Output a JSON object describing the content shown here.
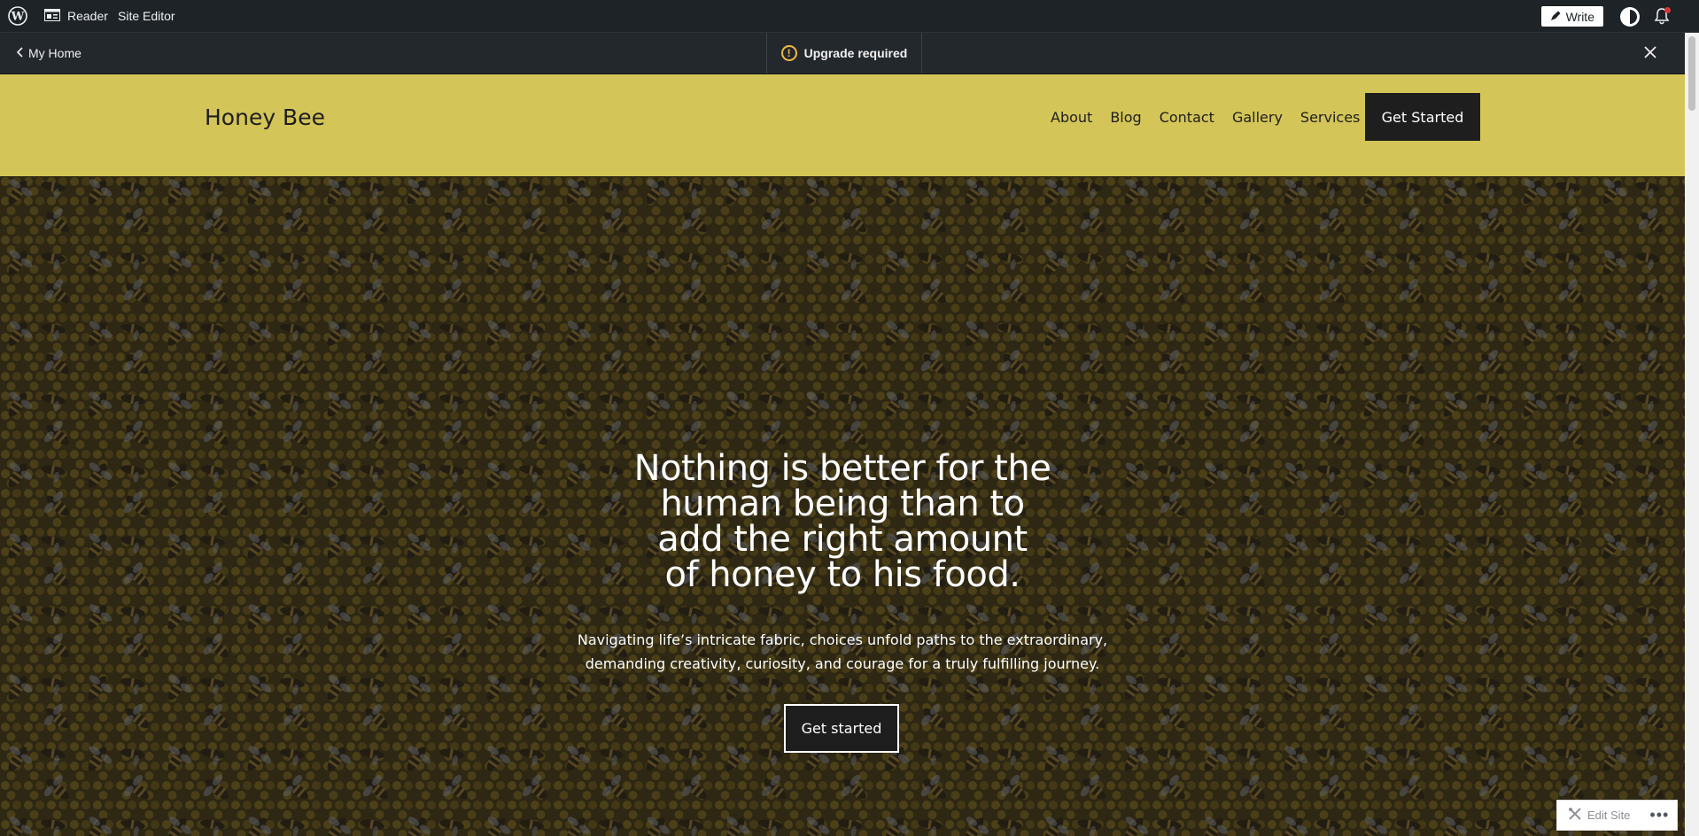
{
  "admin_bar": {
    "reader_label": "Reader",
    "site_editor_label": "Site Editor",
    "write_label": "Write",
    "icons": [
      "wordpress-logo-icon",
      "reader-icon",
      "pencil-icon",
      "avatar",
      "bell-icon"
    ]
  },
  "preview_bar": {
    "back_label": "My Home",
    "upgrade_label": "Upgrade required",
    "warning_glyph": "!"
  },
  "site": {
    "title": "Honey Bee",
    "nav": [
      "About",
      "Blog",
      "Contact",
      "Gallery",
      "Services"
    ],
    "header_cta": "Get Started",
    "header_bg": "#d4c558"
  },
  "hero": {
    "heading_lines": [
      "Nothing is better for the",
      "human being than to",
      "add the right amount",
      "of honey to his food."
    ],
    "subtext_lines": [
      "Navigating life’s intricate fabric, choices unfold paths to the extraordinary,",
      "demanding creativity, curiosity, and courage for a truly fulfilling journey."
    ],
    "button_label": "Get started"
  },
  "floating": {
    "edit_site_label": "Edit Site",
    "more_glyph": "•••"
  }
}
